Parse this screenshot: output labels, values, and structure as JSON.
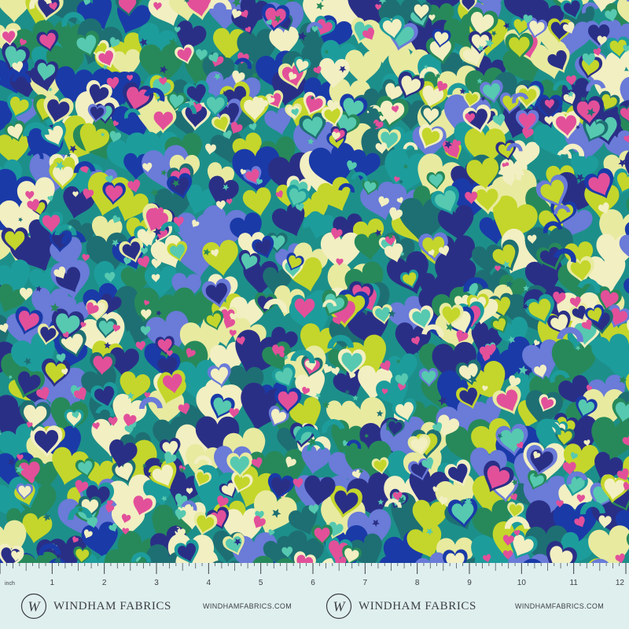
{
  "ruler": {
    "unit_label": "inch",
    "numbers": [
      "1",
      "2",
      "3",
      "4",
      "5",
      "6",
      "7",
      "8",
      "9",
      "10",
      "11",
      "12"
    ]
  },
  "branding": {
    "logo_letter": "W",
    "brand_name": "WINDHAM FABRICS",
    "website": "WINDHAMFABRICS.COM"
  },
  "pattern": {
    "motifs": [
      "heart-icon",
      "star-icon",
      "rainbow-arc"
    ],
    "palette": [
      "#e8eaa0",
      "#c4d62b",
      "#1d9c9c",
      "#1e6f73",
      "#27895a",
      "#2a2f86",
      "#1a3aa8",
      "#e2509a",
      "#56c9b0",
      "#f2efc2",
      "#6a7bd8"
    ]
  }
}
